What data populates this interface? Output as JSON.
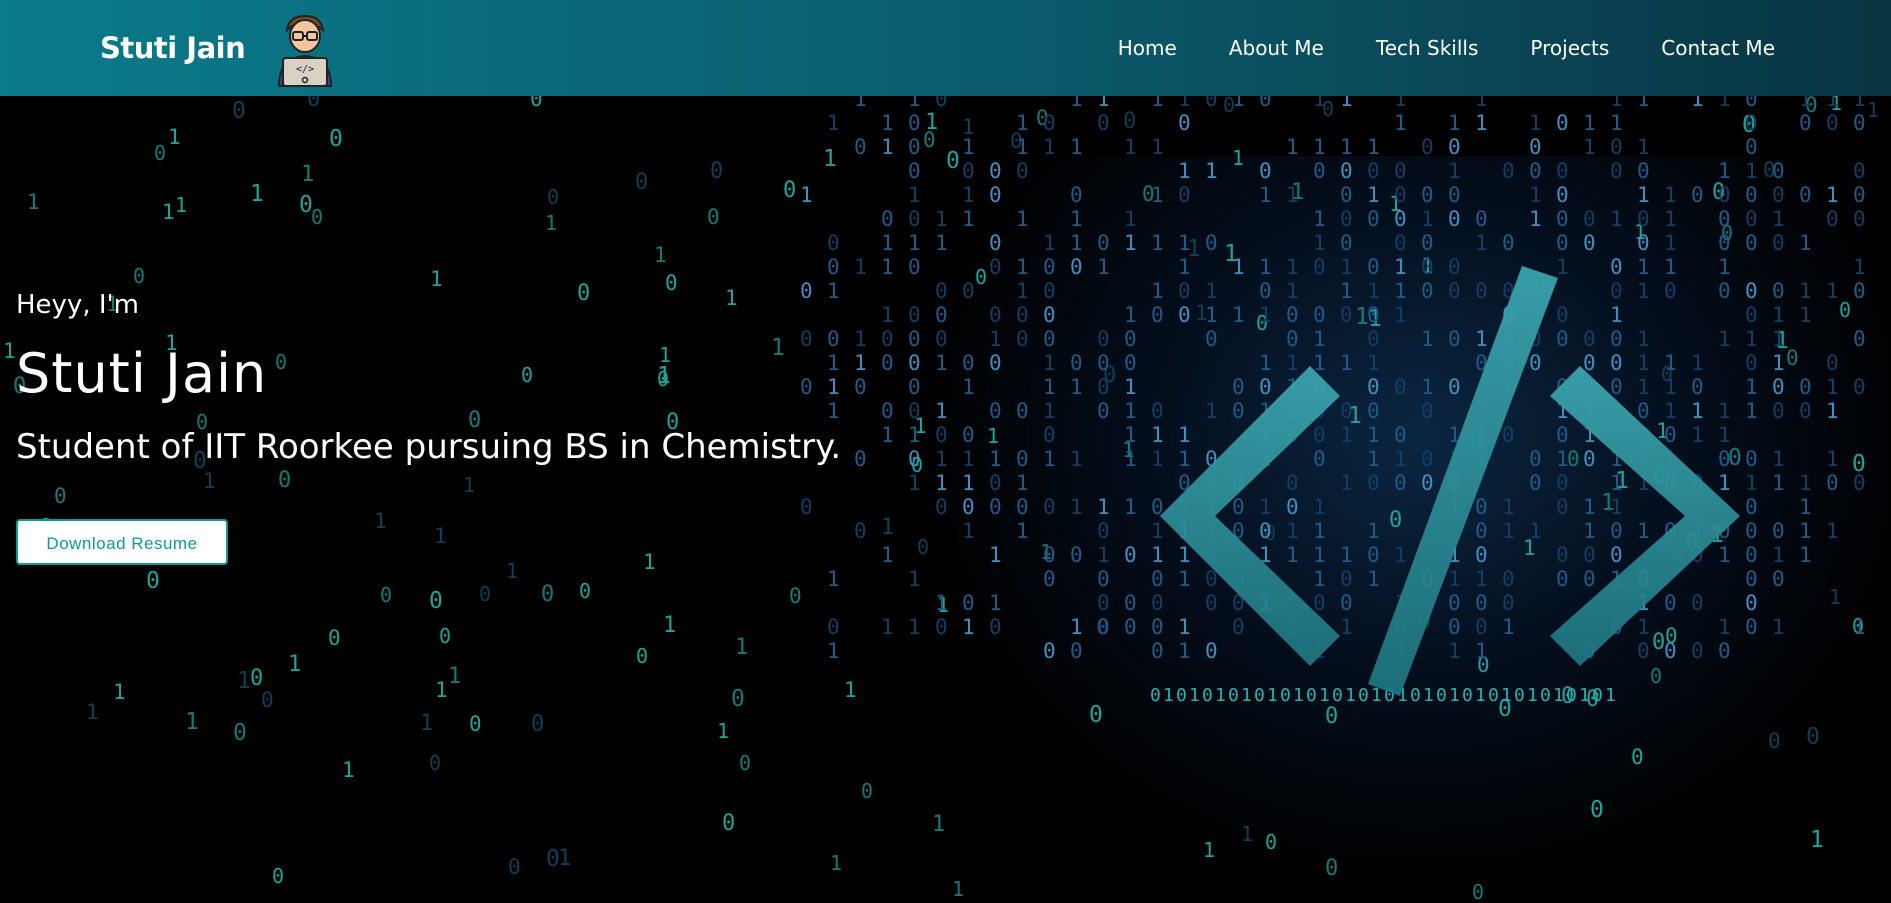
{
  "navbar": {
    "brand_name": "Stuti Jain",
    "brand_logo_icon": "developer-avatar-icon",
    "links": [
      {
        "label": "Home"
      },
      {
        "label": "About Me"
      },
      {
        "label": "Tech Skills"
      },
      {
        "label": "Projects"
      },
      {
        "label": "Contact Me"
      }
    ]
  },
  "hero": {
    "greeting": "Heyy, I'm",
    "name": "Stuti Jain",
    "tagline": "Student of IIT Roorkee pursuing BS in Chemistry.",
    "resume_button": "Download Resume",
    "background_icon": "code-slash-icon"
  },
  "colors": {
    "nav_gradient_start": "#0a7b8b",
    "nav_gradient_end": "#093442",
    "accent": "#0e9a9a",
    "digit_color": "#1aa59a",
    "code_symbol": "#2d8c9a"
  }
}
